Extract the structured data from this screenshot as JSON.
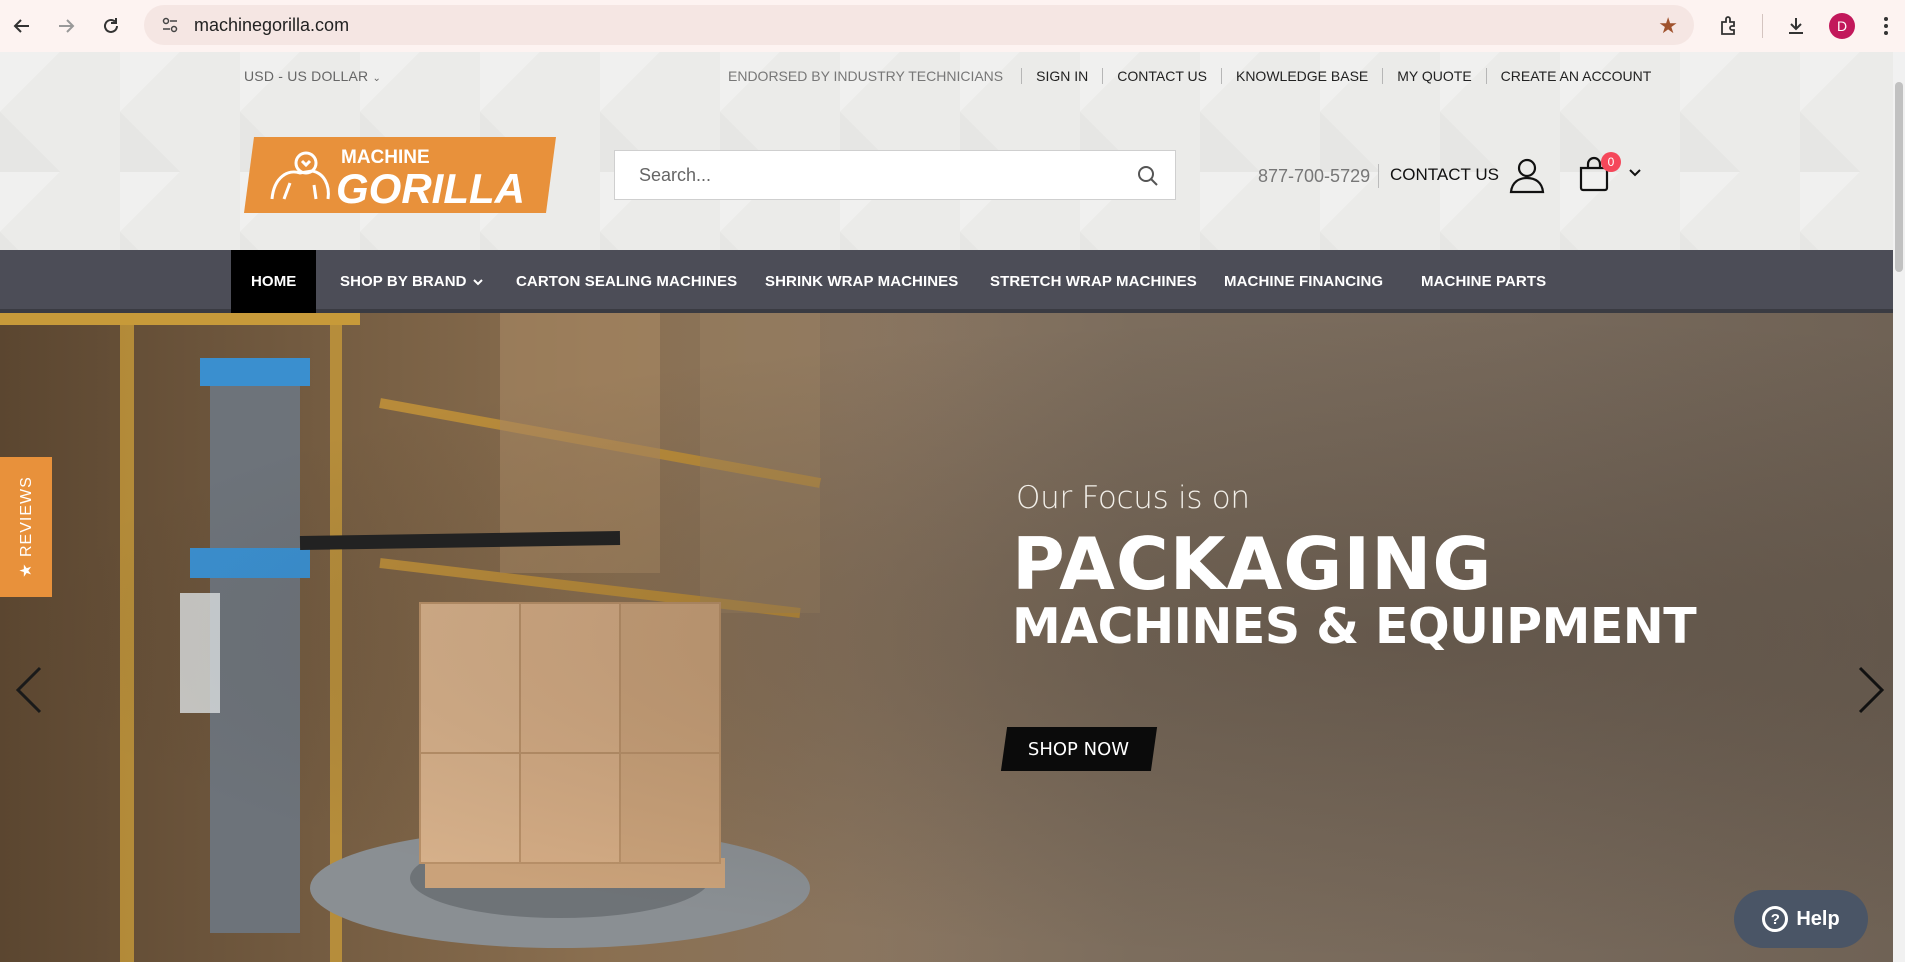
{
  "browser": {
    "url": "machinegorilla.com",
    "profile_initial": "D",
    "back_icon": "arrow-left-icon",
    "forward_icon": "arrow-right-icon",
    "reload_icon": "reload-icon"
  },
  "topbar": {
    "currency": "USD - US DOLLAR",
    "endorsed": "ENDORSED BY INDUSTRY TECHNICIANS",
    "links": [
      "SIGN IN",
      "CONTACT US",
      "KNOWLEDGE BASE",
      "MY QUOTE",
      "CREATE AN ACCOUNT"
    ]
  },
  "header": {
    "logo_top": "MACHINE",
    "logo_bottom": "GORILLA",
    "search_placeholder": "Search...",
    "phone": "877-700-5729",
    "contact": "CONTACT US",
    "cart_count": "0",
    "brand_color": "#e8913b"
  },
  "nav": {
    "items": [
      "HOME",
      "SHOP BY BRAND",
      "CARTON SEALING MACHINES",
      "SHRINK WRAP MACHINES",
      "STRETCH WRAP MACHINES",
      "MACHINE FINANCING",
      "MACHINE PARTS"
    ]
  },
  "hero": {
    "sub": "Our Focus is on",
    "title": "PACKAGING",
    "subtitle": "MACHINES & EQUIPMENT",
    "cta": "SHOP NOW"
  },
  "widgets": {
    "reviews": "★ REVIEWS",
    "help": "Help"
  }
}
